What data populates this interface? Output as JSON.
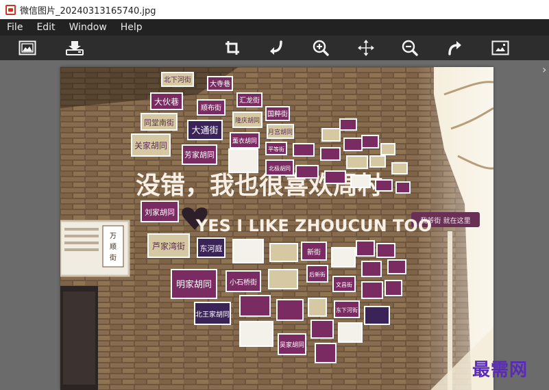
{
  "window": {
    "title": "微信图片_20240313165740.jpg"
  },
  "menu": {
    "items": [
      "File",
      "Edit",
      "Window",
      "Help"
    ]
  },
  "toolbar": {
    "tools": [
      {
        "name": "image-frame-icon",
        "label": "image"
      },
      {
        "name": "save-icon",
        "label": "save"
      },
      {
        "name": "crop-icon",
        "label": "crop"
      },
      {
        "name": "rotate-left-icon",
        "label": "rotate-left"
      },
      {
        "name": "zoom-in-icon",
        "label": "zoom-in"
      },
      {
        "name": "move-icon",
        "label": "move"
      },
      {
        "name": "zoom-out-icon",
        "label": "zoom-out"
      },
      {
        "name": "rotate-right-icon",
        "label": "rotate-right"
      },
      {
        "name": "fit-image-icon",
        "label": "fit"
      }
    ]
  },
  "photo": {
    "slogan_cn": "没错，我也很喜欢周村",
    "slogan_en": "YES I LIKE ZHOUCUN TOO",
    "signs": [
      "北下河街",
      "大寺巷",
      "大伙巷",
      "汇龙街",
      "顺布街",
      "国粹街",
      "同堂南街",
      "大通街",
      "隆庆胡同",
      "月宫胡同",
      "关家胡同",
      "芳家胡同",
      "芦家湾街",
      "东河庭",
      "刘家胡同",
      "明家胡同",
      "小石桥街",
      "北王家胡同",
      "吴家胡同",
      "万顺街",
      "后新街",
      "文昌街",
      "东下河街",
      "我爷街 就在这里"
    ]
  },
  "watermark": {
    "text": "最需网"
  }
}
